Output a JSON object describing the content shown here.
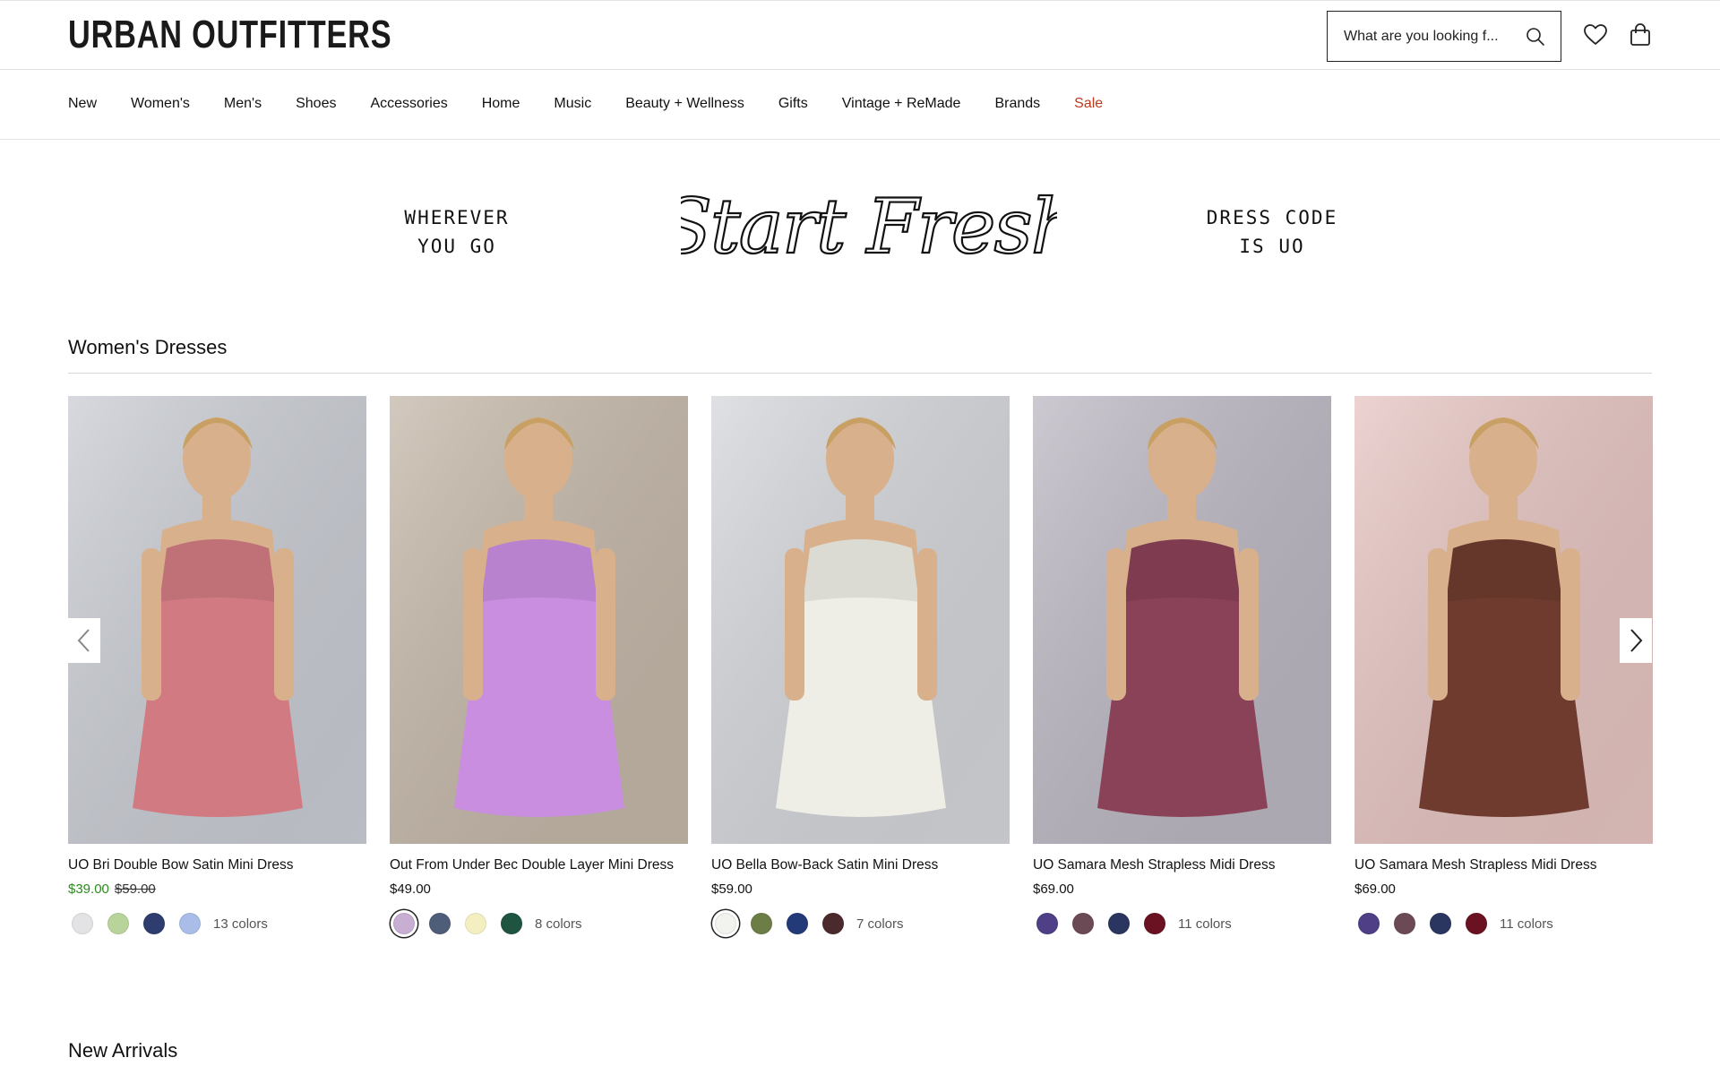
{
  "header": {
    "logo": "URBAN OUTFITTERS",
    "search_placeholder": "What are you looking f...",
    "icons": [
      "search-icon",
      "heart-icon",
      "shopping-bag-icon"
    ]
  },
  "nav": {
    "items": [
      "New",
      "Women's",
      "Men's",
      "Shoes",
      "Accessories",
      "Home",
      "Music",
      "Beauty + Wellness",
      "Gifts",
      "Vintage + ReMade",
      "Brands",
      "Sale"
    ],
    "sale_color": "#c0391b"
  },
  "banner": {
    "left_line1": "WHEREVER",
    "left_line2": "YOU GO",
    "script_text": "Start Fresh",
    "right_line1": "DRESS CODE",
    "right_line2": "IS UO"
  },
  "sections": {
    "dresses_title": "Women's Dresses",
    "new_arrivals_title": "New Arrivals"
  },
  "products": [
    {
      "name": "UO Bri Double Bow Satin Mini Dress",
      "sale_price": "$39.00",
      "original_price": "$59.00",
      "swatches": [
        "#e3e3e6",
        "#b9d49a",
        "#2e3d6e",
        "#a9bde8"
      ],
      "selected_swatch": -1,
      "colors_label": "13 colors",
      "image_bg": "#c9ccd3",
      "garment": "#d17a82"
    },
    {
      "name": "Out From Under Bec Double Layer Mini Dress",
      "price": "$49.00",
      "swatches": [
        "#c8aed3",
        "#4f5e78",
        "#f3efc1",
        "#1f5441"
      ],
      "selected_swatch": 0,
      "colors_label": "8 colors",
      "image_bg": "#c4b7a8",
      "garment": "#c98ee0"
    },
    {
      "name": "UO Bella Bow-Back Satin Mini Dress",
      "price": "$59.00",
      "swatches": [
        "#f2f2ee",
        "#6d7d46",
        "#223a78",
        "#4b2a2d"
      ],
      "selected_swatch": 0,
      "colors_label": "7 colors",
      "image_bg": "#d4d6da",
      "garment": "#eeeee6"
    },
    {
      "name": "UO Samara Mesh Strapless Midi Dress",
      "price": "$69.00",
      "swatches": [
        "#4f3f86",
        "#6c4a55",
        "#2b3660",
        "#6a1222"
      ],
      "selected_swatch": -1,
      "colors_label": "11 colors",
      "image_bg": "#bbb7c2",
      "garment": "#8a4258"
    },
    {
      "name": "UO Samara Mesh Strapless Midi Dress",
      "price": "$69.00",
      "swatches": [
        "#4f3f86",
        "#6c4a55",
        "#2b3660",
        "#6a1222"
      ],
      "selected_swatch": -1,
      "colors_label": "11 colors",
      "image_bg": "#e6c4c1",
      "garment": "#6e3b2e"
    }
  ]
}
